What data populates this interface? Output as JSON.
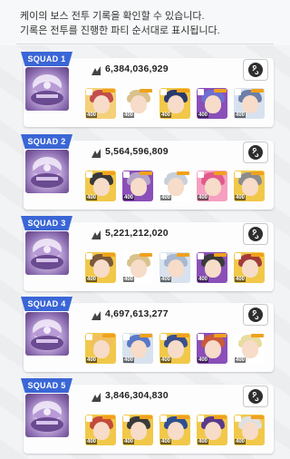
{
  "header": {
    "line1": "케이의 보스 전투 기록을 확인할 수 있습니다.",
    "line2": "기록은 전투를 진행한 파티 순서대로 표시됩니다."
  },
  "squads": [
    {
      "label": "SQUAD 1",
      "score": "6,384,036,929"
    },
    {
      "label": "SQUAD 2",
      "score": "5,564,596,809"
    },
    {
      "label": "SQUAD 3",
      "score": "5,221,212,020"
    },
    {
      "label": "SQUAD 4",
      "score": "4,697,613,277"
    },
    {
      "label": "SQUAD 5",
      "score": "3,846,304,830"
    }
  ],
  "icons": {
    "score": "damage-icon",
    "link": "link-icon",
    "boss": "boss-portrait"
  },
  "level_label": "400",
  "colors": {
    "squad_tag": "#3a66d6",
    "bg": "#f2f3f5"
  }
}
